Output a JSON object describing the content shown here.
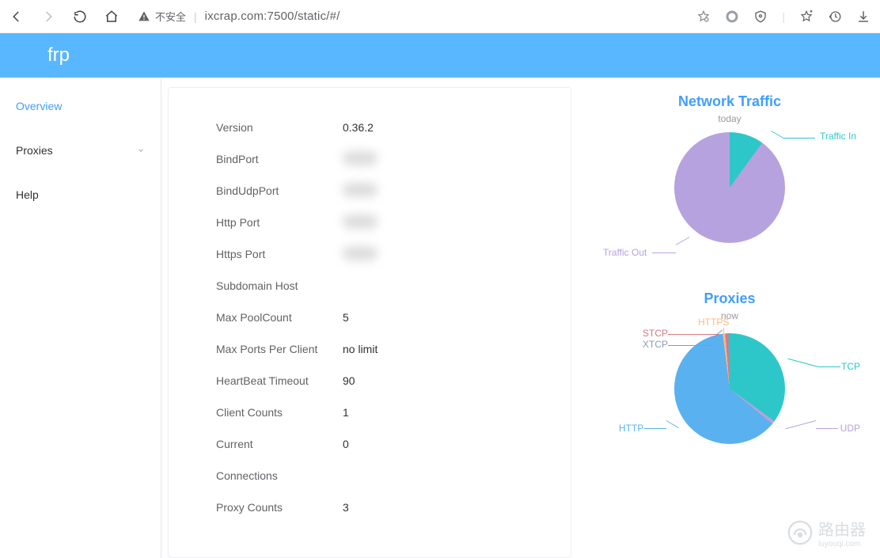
{
  "browser": {
    "security_label": "不安全",
    "url": "ixcrap.com:7500/static/#/"
  },
  "header": {
    "title": "frp"
  },
  "sidebar": {
    "items": [
      {
        "label": "Overview",
        "active": true
      },
      {
        "label": "Proxies",
        "expandable": true
      },
      {
        "label": "Help"
      }
    ]
  },
  "overview": {
    "rows": [
      {
        "label": "Version",
        "value": "0.36.2"
      },
      {
        "label": "BindPort",
        "value": "",
        "blurred": true
      },
      {
        "label": "BindUdpPort",
        "value": "",
        "blurred": true
      },
      {
        "label": "Http Port",
        "value": "",
        "blurred": true
      },
      {
        "label": "Https Port",
        "value": "",
        "blurred": true
      },
      {
        "label": "Subdomain Host",
        "value": ""
      },
      {
        "label": "Max PoolCount",
        "value": "5"
      },
      {
        "label": "Max Ports Per Client",
        "value": "no limit"
      },
      {
        "label": "HeartBeat Timeout",
        "value": "90"
      },
      {
        "label": "Client Counts",
        "value": "1"
      },
      {
        "label": "Current",
        "value": "0"
      },
      {
        "label": "Connections",
        "value": ""
      },
      {
        "label": "Proxy Counts",
        "value": "3"
      }
    ]
  },
  "chart_data": [
    {
      "type": "pie",
      "title": "Network Traffic",
      "subtitle": "today",
      "series": [
        {
          "name": "Traffic In",
          "value": 10,
          "color": "#2EC7C9"
        },
        {
          "name": "Traffic Out",
          "value": 90,
          "color": "#B6A2DE"
        }
      ]
    },
    {
      "type": "pie",
      "title": "Proxies",
      "subtitle": "now",
      "series": [
        {
          "name": "TCP",
          "value": 35,
          "color": "#2EC7C9"
        },
        {
          "name": "UDP",
          "value": 1,
          "color": "#B6A2DE"
        },
        {
          "name": "HTTP",
          "value": 62,
          "color": "#5AB1EF"
        },
        {
          "name": "HTTPS",
          "value": 0.7,
          "color": "#FFB980"
        },
        {
          "name": "STCP",
          "value": 0.7,
          "color": "#D87A80"
        },
        {
          "name": "XTCP",
          "value": 0.6,
          "color": "#8D98B3"
        }
      ]
    }
  ],
  "watermark": {
    "brand": "路由器",
    "sub": "luyouqi.com"
  }
}
